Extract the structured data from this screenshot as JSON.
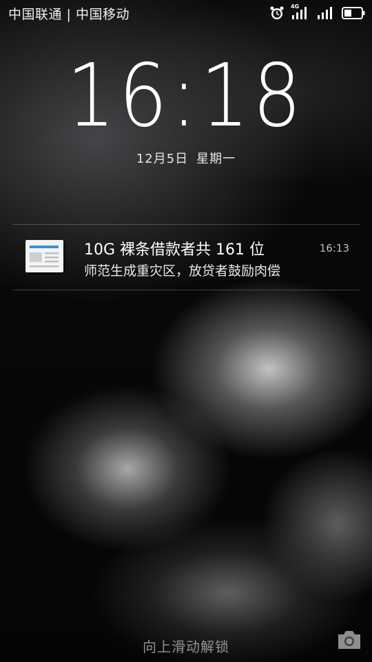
{
  "status_bar": {
    "carrier": "中国联通 | 中国移动",
    "network_badge": "4G",
    "icons": [
      "alarm-icon",
      "signal-4g-icon",
      "signal-icon",
      "battery-icon"
    ]
  },
  "lockscreen": {
    "time": "16:18",
    "date": "12月5日",
    "weekday": "星期一"
  },
  "notification": {
    "app_icon": "news-app-icon",
    "title": "10G 裸条借款者共 161 位",
    "body": "师范生成重灾区，放贷者鼓励肉偿",
    "time": "16:13"
  },
  "footer": {
    "unlock_hint": "向上滑动解锁",
    "camera_icon": "camera-icon"
  },
  "colors": {
    "accent_blue": "#3d8fd6",
    "text": "#ffffff"
  }
}
